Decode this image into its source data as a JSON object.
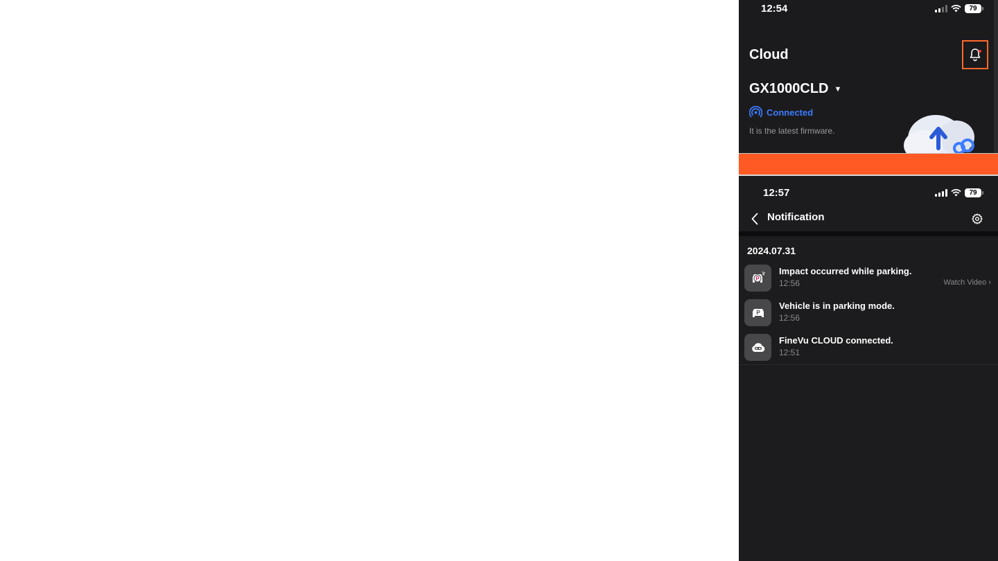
{
  "cloud_screen": {
    "status_time": "12:54",
    "battery": "79",
    "title": "Cloud",
    "device_name": "GX1000CLD",
    "connection_status": "Connected",
    "firmware_text": "It is the latest firmware.",
    "accent_color": "#3c7bff",
    "highlight_color": "#ff6a2c"
  },
  "notification_screen": {
    "status_time": "12:57",
    "battery": "79",
    "title": "Notification",
    "date": "2024.07.31",
    "items": [
      {
        "title": "Impact occurred while parking.",
        "time": "12:56",
        "action": "Watch Video",
        "icon": "parking-impact-icon"
      },
      {
        "title": "Vehicle is in parking mode.",
        "time": "12:56",
        "icon": "parking-mode-icon"
      },
      {
        "title": "FineVu CLOUD connected.",
        "time": "12:51",
        "icon": "cloud-link-icon"
      }
    ]
  },
  "divider_color": "#ff5a24"
}
